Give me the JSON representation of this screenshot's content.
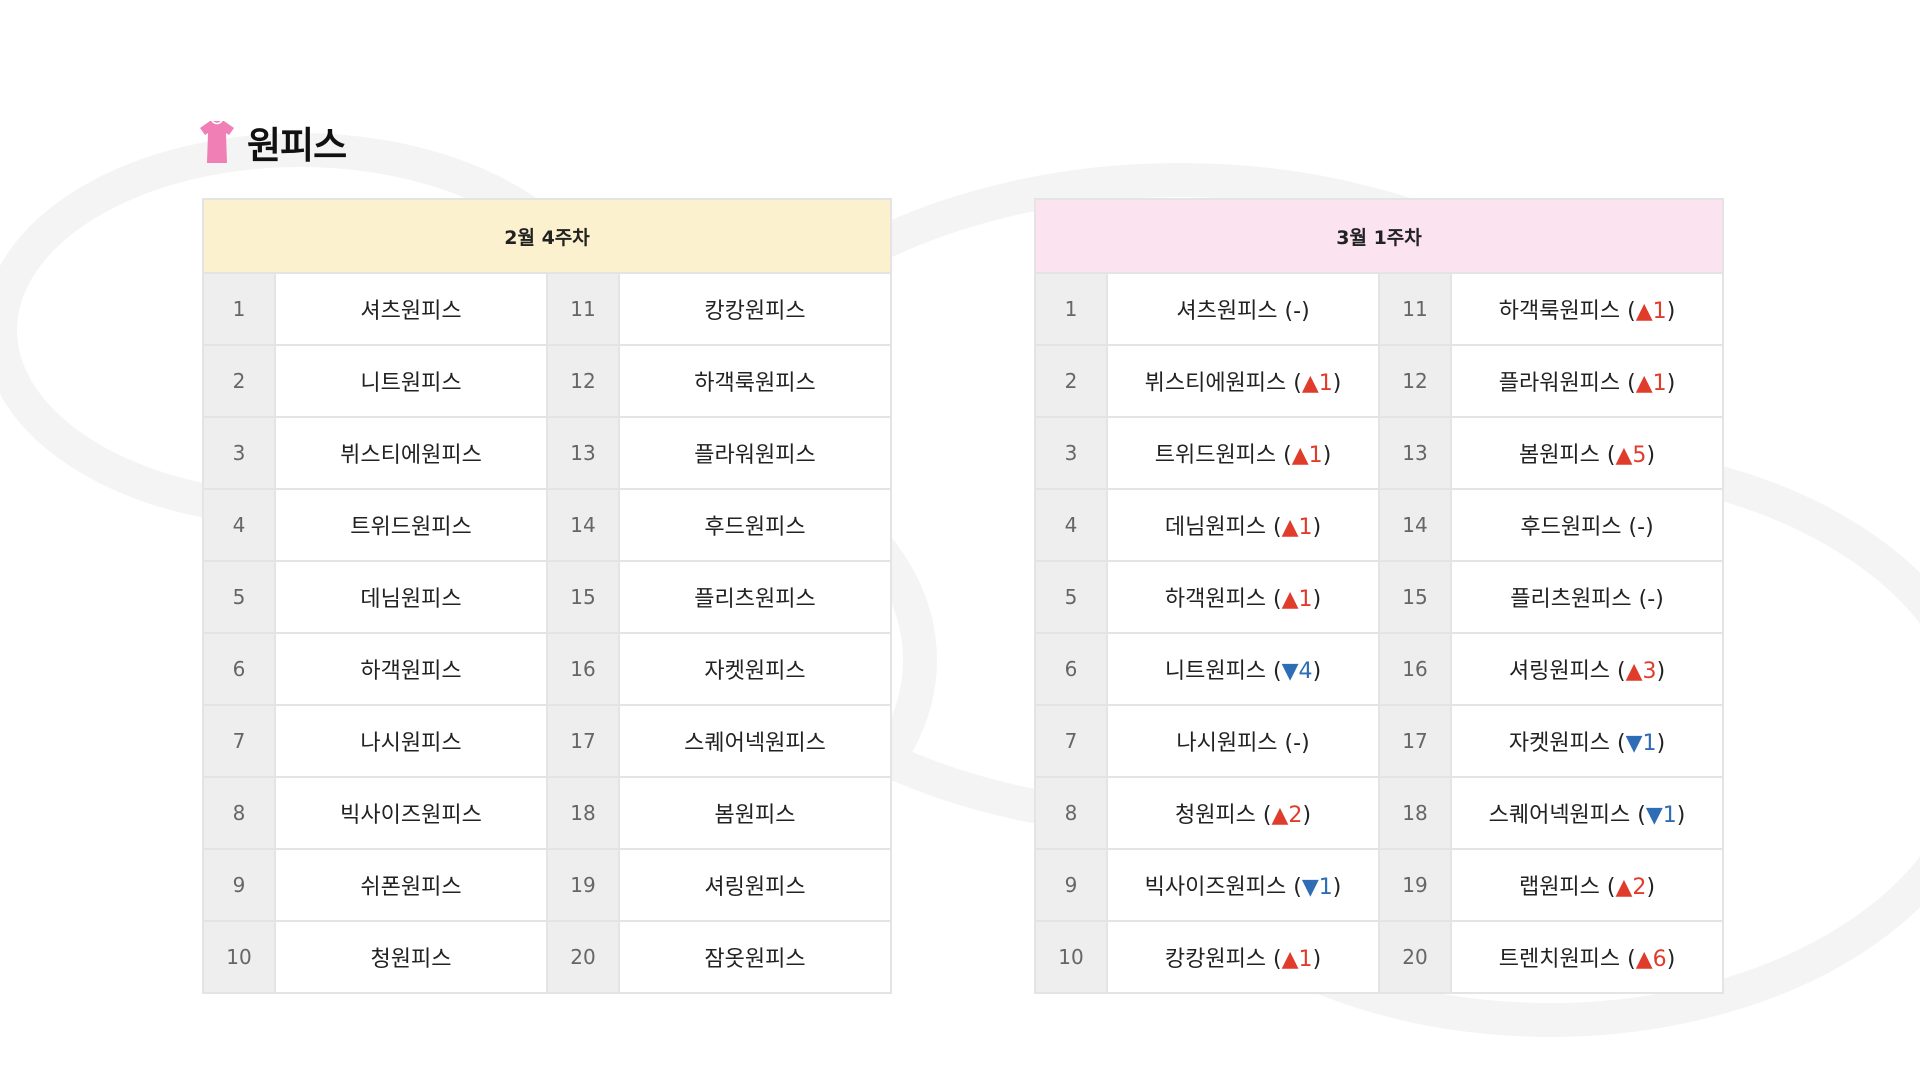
{
  "title": "원피스",
  "icon": "dress-icon",
  "colors": {
    "title_icon": "#f07fb5",
    "left_header_bg": "#fcf1cf",
    "right_header_bg": "#fbe3ef",
    "up": "#e03c2c",
    "down": "#2e6db5"
  },
  "left_table": {
    "header": "2월 4주차",
    "rows": [
      {
        "rank_a": "1",
        "name_a": "셔츠원피스",
        "rank_b": "11",
        "name_b": "캉캉원피스"
      },
      {
        "rank_a": "2",
        "name_a": "니트원피스",
        "rank_b": "12",
        "name_b": "하객룩원피스"
      },
      {
        "rank_a": "3",
        "name_a": "뷔스티에원피스",
        "rank_b": "13",
        "name_b": "플라워원피스"
      },
      {
        "rank_a": "4",
        "name_a": "트위드원피스",
        "rank_b": "14",
        "name_b": "후드원피스"
      },
      {
        "rank_a": "5",
        "name_a": "데님원피스",
        "rank_b": "15",
        "name_b": "플리츠원피스"
      },
      {
        "rank_a": "6",
        "name_a": "하객원피스",
        "rank_b": "16",
        "name_b": "자켓원피스"
      },
      {
        "rank_a": "7",
        "name_a": "나시원피스",
        "rank_b": "17",
        "name_b": "스퀘어넥원피스"
      },
      {
        "rank_a": "8",
        "name_a": "빅사이즈원피스",
        "rank_b": "18",
        "name_b": "봄원피스"
      },
      {
        "rank_a": "9",
        "name_a": "쉬폰원피스",
        "rank_b": "19",
        "name_b": "셔링원피스"
      },
      {
        "rank_a": "10",
        "name_a": "청원피스",
        "rank_b": "20",
        "name_b": "잠옷원피스"
      }
    ]
  },
  "right_table": {
    "header": "3월 1주차",
    "rows": [
      {
        "rank_a": "1",
        "name_a": "셔츠원피스",
        "change_a": "(-)",
        "dir_a": "none",
        "rank_b": "11",
        "name_b": "하객룩원피스",
        "change_b": "▲1",
        "dir_b": "up"
      },
      {
        "rank_a": "2",
        "name_a": "뷔스티에원피스",
        "change_a": "▲1",
        "dir_a": "up",
        "rank_b": "12",
        "name_b": "플라워원피스",
        "change_b": "▲1",
        "dir_b": "up"
      },
      {
        "rank_a": "3",
        "name_a": "트위드원피스",
        "change_a": "▲1",
        "dir_a": "up",
        "rank_b": "13",
        "name_b": "봄원피스",
        "change_b": "▲5",
        "dir_b": "up"
      },
      {
        "rank_a": "4",
        "name_a": "데님원피스",
        "change_a": "▲1",
        "dir_a": "up",
        "rank_b": "14",
        "name_b": "후드원피스",
        "change_b": "(-)",
        "dir_b": "none"
      },
      {
        "rank_a": "5",
        "name_a": "하객원피스",
        "change_a": "▲1",
        "dir_a": "up",
        "rank_b": "15",
        "name_b": "플리츠원피스",
        "change_b": "(-)",
        "dir_b": "none"
      },
      {
        "rank_a": "6",
        "name_a": "니트원피스",
        "change_a": "▼4",
        "dir_a": "down",
        "rank_b": "16",
        "name_b": "셔링원피스",
        "change_b": "▲3",
        "dir_b": "up"
      },
      {
        "rank_a": "7",
        "name_a": "나시원피스",
        "change_a": "(-)",
        "dir_a": "none",
        "rank_b": "17",
        "name_b": "자켓원피스",
        "change_b": "▼1",
        "dir_b": "down"
      },
      {
        "rank_a": "8",
        "name_a": "청원피스",
        "change_a": "▲2",
        "dir_a": "up",
        "rank_b": "18",
        "name_b": "스퀘어넥원피스",
        "change_b": "▼1",
        "dir_b": "down"
      },
      {
        "rank_a": "9",
        "name_a": "빅사이즈원피스",
        "change_a": "▼1",
        "dir_a": "down",
        "rank_b": "19",
        "name_b": "랩원피스",
        "change_b": "▲2",
        "dir_b": "up"
      },
      {
        "rank_a": "10",
        "name_a": "캉캉원피스",
        "change_a": "▲1",
        "dir_a": "up",
        "rank_b": "20",
        "name_b": "트렌치원피스",
        "change_b": "▲6",
        "dir_b": "up"
      }
    ]
  }
}
